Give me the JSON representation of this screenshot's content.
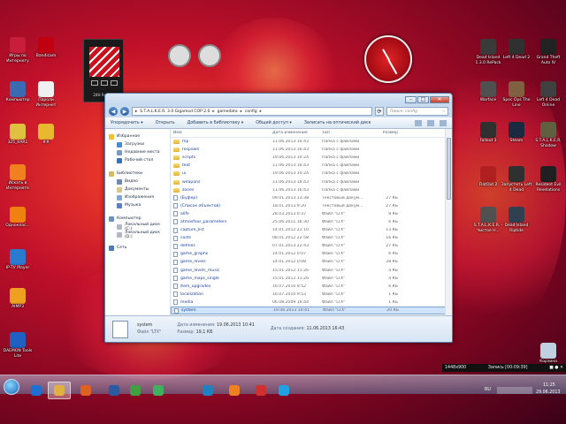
{
  "desktop": {
    "left_icons": [
      {
        "label": "Игры по Интернету",
        "icon": "games-icon",
        "color": "#c81e3c"
      },
      {
        "label": "Bandicam",
        "icon": "bandicam-icon",
        "color": "#c00010"
      },
      {
        "label": "Компьютер",
        "icon": "computer-icon",
        "color": "#3a6ab0"
      },
      {
        "label": "Пароли Интернет",
        "icon": "passwords-doc-icon",
        "color": "#f0f0f0"
      },
      {
        "label": "325_RAR1",
        "icon": "rar-icon",
        "color": "#e0c040"
      },
      {
        "label": "##",
        "icon": "folder-icon",
        "color": "#e8b830"
      },
      {
        "label": "Искать в Интернете",
        "icon": "search-web-icon",
        "color": "#f08020"
      },
      {
        "label": "Одноклас...",
        "icon": "odnoklassniki-icon",
        "color": "#f08010"
      },
      {
        "label": "IP-TV Player",
        "icon": "iptv-icon",
        "color": "#2a7ad0"
      },
      {
        "label": "AIMP3",
        "icon": "aimp-icon",
        "color": "#f0a020"
      },
      {
        "label": "DAEMON Tools Lite",
        "icon": "daemon-tools-icon",
        "color": "#2060c0"
      }
    ],
    "right_icons": [
      {
        "label": "Dead Island 1.3.0 RePack",
        "icon": "dead-island-icon",
        "color": "#3a3a3a"
      },
      {
        "label": "Left 4 Dead 2",
        "icon": "left4dead-icon",
        "color": "#303030"
      },
      {
        "label": "Grand Theft Auto IV",
        "icon": "gta4-icon",
        "color": "#222222"
      },
      {
        "label": "Warface",
        "icon": "warface-icon",
        "color": "#505050"
      },
      {
        "label": "Spec Ops The Line",
        "icon": "specops-icon",
        "color": "#806040"
      },
      {
        "label": "Left 4 Dead Online",
        "icon": "l4d-online-icon",
        "color": "#404040"
      },
      {
        "label": "Fallout 3",
        "icon": "fallout-icon",
        "color": "#303030"
      },
      {
        "label": "Steam",
        "icon": "steam-icon",
        "color": "#1a2a40"
      },
      {
        "label": "S.T.A.L.K.E.R. Shadow",
        "icon": "stalker-icon",
        "color": "#606040"
      },
      {
        "label": "FlatOut 2",
        "icon": "flatout-icon",
        "color": "#b02020"
      },
      {
        "label": "Запустить Left 4 Dead",
        "icon": "l4d-launch-icon",
        "color": "#303030"
      },
      {
        "label": "Resident Evil Revelations",
        "icon": "resident-evil-icon",
        "color": "#202020"
      },
      {
        "label": "S.T.A.L.K.E.R. - Чистое Н...",
        "icon": "stalker-cs-icon",
        "color": "#505050"
      },
      {
        "label": "Dead Island Riptide",
        "icon": "riptide-icon",
        "color": "#304050"
      },
      {
        "label": "Корзина",
        "icon": "recycle-bin-icon",
        "color": "#c0d0e0"
      }
    ],
    "gadget_label": "24H Record"
  },
  "explorer": {
    "search_placeholder": "Поиск: config",
    "path": [
      "S.T.A.L.K.E.R. 3.0 Gigamod COP 2.0",
      "gamedata",
      "config"
    ],
    "toolbar": [
      "Упорядочить ▾",
      "Открыть",
      "Добавить в библиотеку ▾",
      "Общий доступ ▾",
      "Записать на оптический диск"
    ],
    "nav": {
      "favorites": {
        "title": "Избранное",
        "items": [
          "Загрузки",
          "Недавние места",
          "Рабочий стол"
        ]
      },
      "libraries": {
        "title": "Библиотеки",
        "items": [
          "Видео",
          "Документы",
          "Изображения",
          "Музыка"
        ]
      },
      "computer": {
        "title": "Компьютер",
        "items": [
          "Локальный диск (C:)",
          "Локальный диск (D:)"
        ]
      },
      "network": {
        "title": "Сеть"
      }
    },
    "columns": [
      "Имя",
      "Дата изменения",
      "Тип",
      "Размер"
    ],
    "rows": [
      {
        "name": "mp",
        "date": "11.06.2013 16:43",
        "type": "Папка с файлами",
        "size": "",
        "kind": "folder"
      },
      {
        "name": "respawn",
        "date": "11.06.2013 16:43",
        "type": "Папка с файлами",
        "size": "",
        "kind": "folder"
      },
      {
        "name": "scripts",
        "date": "19.06.2013 10:24",
        "type": "Папка с файлами",
        "size": "",
        "kind": "folder"
      },
      {
        "name": "text",
        "date": "11.06.2013 16:43",
        "type": "Папка с файлами",
        "size": "",
        "kind": "folder"
      },
      {
        "name": "ui",
        "date": "19.06.2013 10:24",
        "type": "Папка с файлами",
        "size": "",
        "kind": "folder"
      },
      {
        "name": "weapons",
        "date": "11.06.2013 16:43",
        "type": "Папка с файлами",
        "size": "",
        "kind": "folder"
      },
      {
        "name": "zones",
        "date": "11.06.2013 16:43",
        "type": "Папка с файлами",
        "size": "",
        "kind": "folder"
      },
      {
        "name": "(Буфер)",
        "date": "09.01.2013 13:38",
        "type": "Текстовый докум...",
        "size": "27 КБ",
        "kind": "file"
      },
      {
        "name": "(Список объектов)",
        "date": "18.01.2013 9:20",
        "type": "Текстовый докум...",
        "size": "27 КБ",
        "kind": "file"
      },
      {
        "name": "alife",
        "date": "28.03.2013 0:37",
        "type": "Файл \"LTX\"",
        "size": "8 КБ",
        "kind": "file"
      },
      {
        "name": "atmosfear_parameters",
        "date": "25.06.2011 16:30",
        "type": "Файл \"LTX\"",
        "size": "6 КБ",
        "kind": "file"
      },
      {
        "name": "capture_list",
        "date": "14.01.2012 21:10",
        "type": "Файл \"LTX\"",
        "size": "13 КБ",
        "kind": "file"
      },
      {
        "name": "costs",
        "date": "08.01.2012 22:58",
        "type": "Файл \"LTX\"",
        "size": "16 КБ",
        "kind": "file"
      },
      {
        "name": "defines",
        "date": "07.01.2013 22:43",
        "type": "Файл \"LTX\"",
        "size": "27 КБ",
        "kind": "file"
      },
      {
        "name": "game_graphs",
        "date": "14.01.2012 0:07",
        "type": "Файл \"LTX\"",
        "size": "6 КБ",
        "kind": "file"
      },
      {
        "name": "game_levels",
        "date": "14.01.2012 0:08",
        "type": "Файл \"LTX\"",
        "size": "28 КБ",
        "kind": "file"
      },
      {
        "name": "game_levels_music",
        "date": "15.01.2012 11:26",
        "type": "Файл \"LTX\"",
        "size": "4 КБ",
        "kind": "file"
      },
      {
        "name": "game_maps_single",
        "date": "15.01.2012 11:26",
        "type": "Файл \"LTX\"",
        "size": "4 КБ",
        "kind": "file"
      },
      {
        "name": "item_upgrades",
        "date": "16.07.2010 9:52",
        "type": "Файл \"LTX\"",
        "size": "6 КБ",
        "kind": "file"
      },
      {
        "name": "localization",
        "date": "16.07.2010 9:53",
        "type": "Файл \"LTX\"",
        "size": "1 КБ",
        "kind": "file"
      },
      {
        "name": "media",
        "date": "06.08.2009 16:44",
        "type": "Файл \"LTX\"",
        "size": "1 КБ",
        "kind": "file"
      },
      {
        "name": "system",
        "date": "19.06.2013 10:41",
        "type": "Файл \"LTX\"",
        "size": "20 КБ",
        "kind": "file",
        "selected": true
      }
    ],
    "details": {
      "name": "system",
      "file_type": "Файл \"LTX\"",
      "modified_label": "Дата изменения:",
      "modified": "19.06.2013 10:41",
      "created_label": "Дата создания:",
      "created": "11.06.2013 16:43",
      "size_label": "Размер:",
      "size": "19,1 КБ"
    }
  },
  "recorder_bar": {
    "resolution": "1448x900",
    "status": "Запись [00:09:39]"
  },
  "taskbar": {
    "lang": "RU",
    "time": "11:25",
    "date": "29.06.2013",
    "apps": [
      "ie-icon",
      "explorer-icon",
      "firefox-icon",
      "media-player-icon",
      "chrome-icon",
      "camera-icon",
      "browser-icon",
      "odnoklassniki-icon",
      "yandex-icon",
      "skype-icon"
    ]
  }
}
